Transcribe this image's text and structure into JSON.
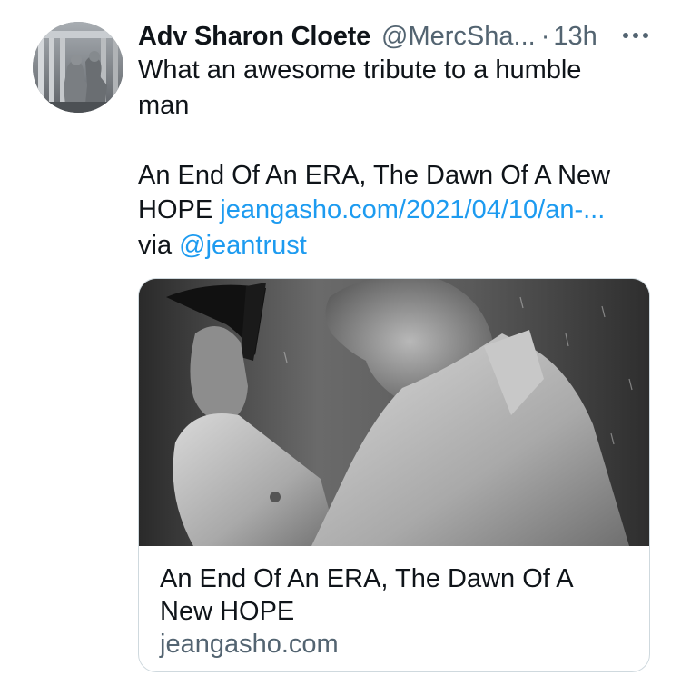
{
  "tweet": {
    "display_name": "Adv Sharon Cloete",
    "handle": "@MercSha...",
    "separator": "·",
    "timestamp": "13h",
    "more_icon": "more-horizontal-icon",
    "text": {
      "line1": "What an awesome tribute to a humble",
      "line2": "man",
      "line3": "An End Of An ERA, The Dawn Of A New",
      "line4_prefix": "HOPE ",
      "link_url": "jeangasho.com/2021/04/10/an-...",
      "line5_prefix": "via ",
      "mention": "@jeantrust"
    },
    "card": {
      "title": "An End Of An ERA, The Dawn Of A New HOPE",
      "domain": "jeangasho.com"
    }
  },
  "colors": {
    "text": "#0f1419",
    "secondary": "#536471",
    "link": "#1d9bf0",
    "border": "#cfd9de"
  }
}
